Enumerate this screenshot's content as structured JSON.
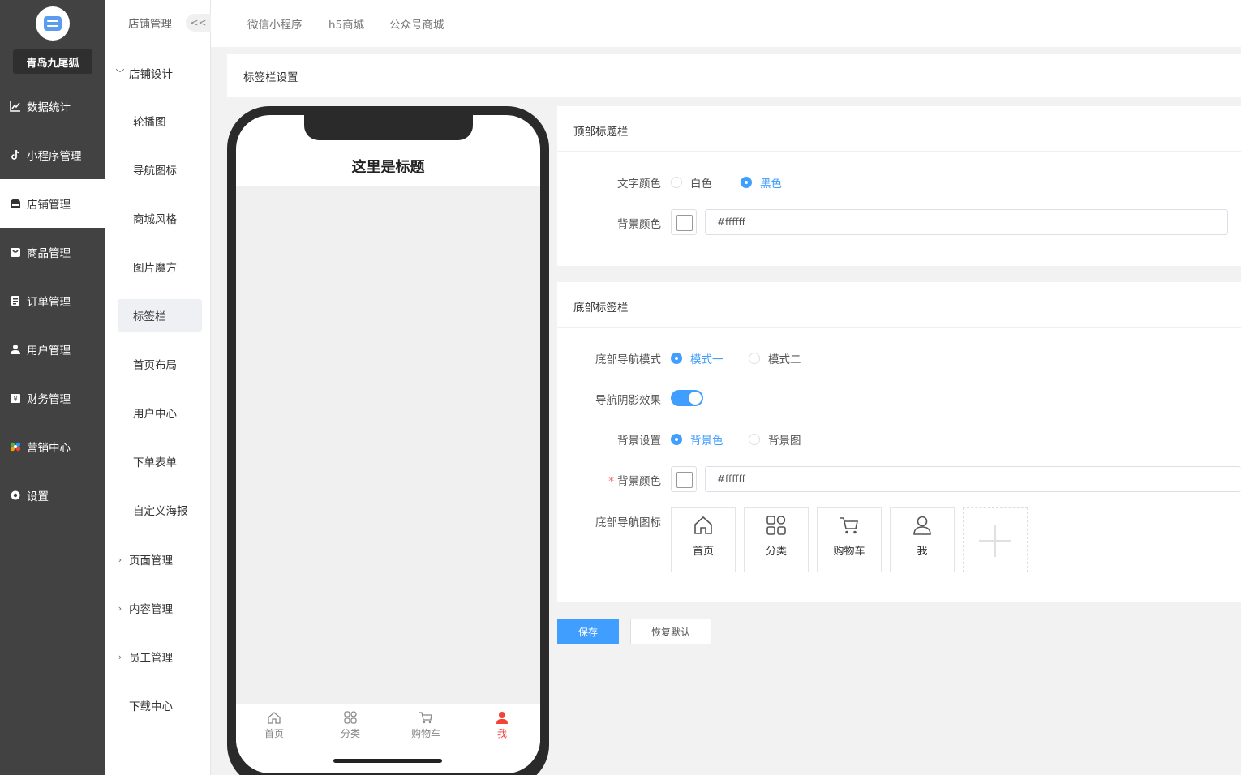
{
  "sidebar": {
    "shop_name": "青岛九尾狐",
    "items": [
      {
        "label": "数据统计",
        "icon": "chart-icon"
      },
      {
        "label": "小程序管理",
        "icon": "tiktok-icon"
      },
      {
        "label": "店铺管理",
        "icon": "shop-icon"
      },
      {
        "label": "商品管理",
        "icon": "bag-icon"
      },
      {
        "label": "订单管理",
        "icon": "clipboard-icon"
      },
      {
        "label": "用户管理",
        "icon": "user-icon"
      },
      {
        "label": "财务管理",
        "icon": "finance-icon"
      },
      {
        "label": "营销中心",
        "icon": "marketing-icon"
      },
      {
        "label": "设置",
        "icon": "gear-icon"
      }
    ],
    "active_index": 2
  },
  "submenu": {
    "title": "店铺管理",
    "collapse_label": "<<",
    "design_group": "店铺设计",
    "design_items": [
      "轮播图",
      "导航图标",
      "商城风格",
      "图片魔方",
      "标签栏",
      "首页布局",
      "用户中心",
      "下单表单",
      "自定义海报"
    ],
    "active_item": "标签栏",
    "other_groups": [
      "页面管理",
      "内容管理",
      "员工管理"
    ],
    "download": "下载中心"
  },
  "top_tabs": [
    "微信小程序",
    "h5商城",
    "公众号商城"
  ],
  "page_heading": "标签栏设置",
  "phone": {
    "title": "这里是标题",
    "tabs": [
      {
        "label": "首页",
        "icon": "home-icon"
      },
      {
        "label": "分类",
        "icon": "category-icon"
      },
      {
        "label": "购物车",
        "icon": "cart-icon"
      },
      {
        "label": "我",
        "icon": "user-icon"
      }
    ],
    "selected_tab": 3,
    "selected_color": "#f44336"
  },
  "top_bar_panel": {
    "heading": "顶部标题栏",
    "text_color_label": "文字颜色",
    "text_color_options": [
      "白色",
      "黑色"
    ],
    "text_color_selected": "黑色",
    "bg_color_label": "背景颜色",
    "bg_color_value": "#ffffff"
  },
  "bottom_bar_panel": {
    "heading": "底部标签栏",
    "mode_label": "底部导航模式",
    "mode_options": [
      "模式一",
      "模式二"
    ],
    "mode_selected": "模式一",
    "shadow_label": "导航阴影效果",
    "shadow_on": true,
    "bg_setting_label": "背景设置",
    "bg_setting_options": [
      "背景色",
      "背景图"
    ],
    "bg_setting_selected": "背景色",
    "bg_color_label": "背景颜色",
    "bg_color_value": "#ffffff",
    "icons_label": "底部导航图标",
    "icons": [
      {
        "label": "首页",
        "icon": "home-icon"
      },
      {
        "label": "分类",
        "icon": "category-icon"
      },
      {
        "label": "购物车",
        "icon": "cart-icon"
      },
      {
        "label": "我",
        "icon": "user-icon"
      }
    ]
  },
  "actions": {
    "save": "保存",
    "restore": "恢复默认"
  },
  "colors": {
    "accent": "#409eff",
    "sidebar_bg": "#424242",
    "tab_selected": "#f44336"
  }
}
